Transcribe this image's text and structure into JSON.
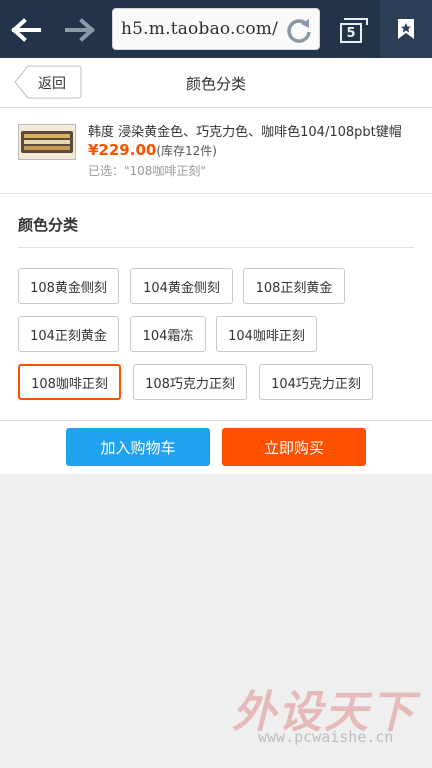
{
  "browser": {
    "url": "h5.m.taobao.com/",
    "tab_count": "5",
    "colors": {
      "bar": "#233449",
      "bookmark_bg": "#2b3e55"
    }
  },
  "header": {
    "back_label": "返回",
    "title": "颜色分类"
  },
  "product": {
    "name": "韩度 浸染黄金色、巧克力色、咖啡色104/108pbt键帽",
    "price": "¥229.00",
    "stock": "(库存12件)",
    "selected": "已选：\"108咖啡正刻\"",
    "price_color": "#ff5000"
  },
  "color_section": {
    "title": "颜色分类",
    "options": [
      {
        "label": "108黄金侧刻",
        "selected": false
      },
      {
        "label": "104黄金侧刻",
        "selected": false
      },
      {
        "label": "108正刻黄金",
        "selected": false
      },
      {
        "label": "104正刻黄金",
        "selected": false
      },
      {
        "label": "104霜冻",
        "selected": false
      },
      {
        "label": "104咖啡正刻",
        "selected": false
      },
      {
        "label": "108咖啡正刻",
        "selected": true
      },
      {
        "label": "108巧克力正刻",
        "selected": false
      },
      {
        "label": "104巧克力正刻",
        "selected": false
      }
    ]
  },
  "actions": {
    "add_to_cart": "加入购物车",
    "buy_now": "立即购买",
    "cart_color": "#20a2ef",
    "buy_color": "#ff5000"
  },
  "watermark": {
    "brand": "外设天下",
    "url": "www.pcwaishe.cn"
  }
}
